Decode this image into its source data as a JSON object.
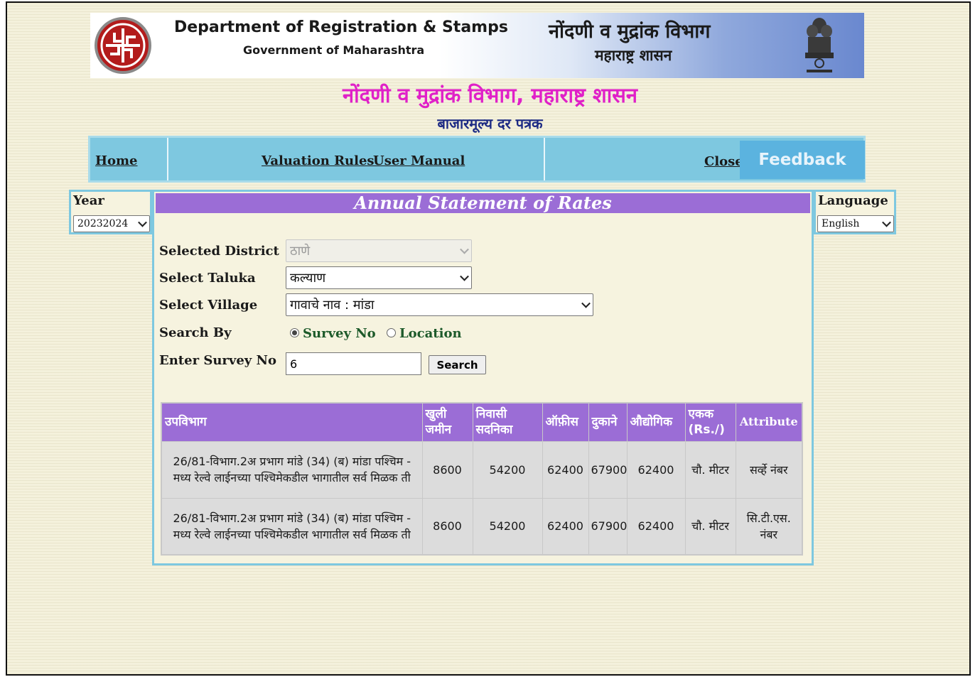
{
  "banner": {
    "dept_en": "Department of Registration & Stamps",
    "gov_en": "Government of Maharashtra",
    "dept_mr": "नोंदणी व मुद्रांक विभाग",
    "gov_mr": "महाराष्ट्र शासन",
    "logo_icon": "department-seal-logo",
    "emblem_icon": "state-emblem-icon"
  },
  "page": {
    "title": "नोंदणी व मुद्रांक विभाग, महाराष्ट्र शासन",
    "subtitle": "बाजारमूल्य दर पत्रक"
  },
  "nav": {
    "home": "Home",
    "valuation_rules": "Valuation Rules",
    "user_manual": "User Manual",
    "close": "Close",
    "feedback": "Feedback"
  },
  "year": {
    "label": "Year",
    "selected": "20232024"
  },
  "language": {
    "label": "Language",
    "selected": "English"
  },
  "form": {
    "heading": "Annual Statement of Rates",
    "district_label": "Selected District",
    "district_value": "ठाणे",
    "taluka_label": "Select Taluka",
    "taluka_value": "कल्याण",
    "village_label": "Select Village",
    "village_value": "गावाचे नाव : मांडा",
    "search_by_label": "Search By",
    "search_by_options": [
      "Survey No",
      "Location"
    ],
    "search_by_selected": "Survey No",
    "survey_label": "Enter Survey No",
    "survey_value": "6",
    "search_button": "Search"
  },
  "table": {
    "headers": [
      "उपविभाग",
      "खुली जमीन",
      "निवासी सदनिका",
      "ऑफ़ीस",
      "दुकाने",
      "औद्योगिक",
      "एकक (Rs./)",
      "Attribute"
    ],
    "rows": [
      [
        "26/81-विभाग.2अ प्रभाग मांडे (34) (ब) मांडा पश्चिम - मध्य रेल्वे लाईनच्या पश्चिमेकडील भागातील सर्व मिळक ती",
        "8600",
        "54200",
        "62400",
        "67900",
        "62400",
        "चौ. मीटर",
        "सर्व्हे नंबर"
      ],
      [
        "26/81-विभाग.2अ प्रभाग मांडे (34) (ब) मांडा पश्चिम - मध्य रेल्वे लाईनच्या पश्चिमेकडील भागातील सर्व मिळक ती",
        "8600",
        "54200",
        "62400",
        "67900",
        "62400",
        "चौ. मीटर",
        "सि.टी.एस. नंबर"
      ]
    ]
  }
}
